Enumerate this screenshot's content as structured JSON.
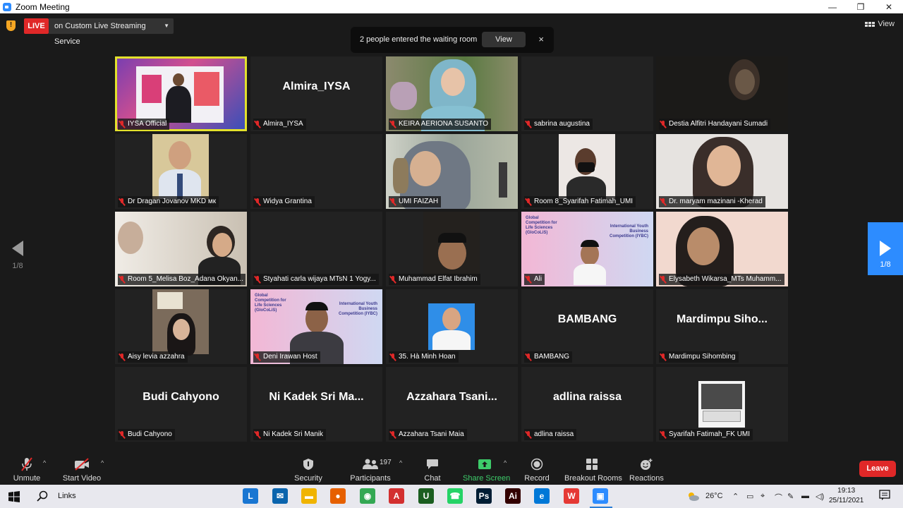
{
  "window": {
    "title": "Zoom Meeting",
    "controls": [
      "—",
      "❐",
      "✕"
    ]
  },
  "live": {
    "badge": "LIVE",
    "stream_label": "on Custom Live Streaming Service"
  },
  "notification": {
    "message": "2 people entered the waiting room",
    "view_label": "View",
    "close": "×"
  },
  "view_toggle": "View",
  "pagination": {
    "left": "1/8",
    "right": "1/8"
  },
  "tiles": [
    {
      "caption": "IYSA Official",
      "big": "",
      "active": true,
      "muted": false
    },
    {
      "caption": "Almira_IYSA",
      "big": "Almira_IYSA",
      "muted": true
    },
    {
      "caption": "KEIRA AERIONA SUSANTO",
      "big": "",
      "muted": true
    },
    {
      "caption": "sabrina augustina",
      "big": "",
      "muted": true
    },
    {
      "caption": "Destia Alfitri Handayani Sumadi",
      "big": "",
      "muted": true
    },
    {
      "caption": "Dr Dragan Jovanov MKD мк",
      "big": "",
      "muted": true
    },
    {
      "caption": "Widya Grantina",
      "big": "",
      "muted": true
    },
    {
      "caption": "UMI FAIZAH",
      "big": "",
      "muted": true
    },
    {
      "caption": "Room 8_Syarifah Fatimah_UMI",
      "big": "",
      "muted": true
    },
    {
      "caption": "Dr. maryam mazinani -Kherad",
      "big": "",
      "muted": true
    },
    {
      "caption": "Room 5_Melisa Boz_Adana Okyan...",
      "big": "",
      "muted": true
    },
    {
      "caption": "Styahati carla wijaya MTsN 1 Yogy...",
      "big": "",
      "muted": true
    },
    {
      "caption": "Muhammad Elfat Ibrahim",
      "big": "",
      "muted": true
    },
    {
      "caption": "Ali",
      "big": "",
      "muted": true
    },
    {
      "caption": "Elysabeth Wikarsa_MTs Muhamm...",
      "big": "",
      "muted": true
    },
    {
      "caption": "Aisy levia azzahra",
      "big": "",
      "muted": true
    },
    {
      "caption": "Deni Irawan Host",
      "big": "",
      "muted": true
    },
    {
      "caption": "35. Hà Minh Hoan",
      "big": "",
      "muted": true
    },
    {
      "caption": "BAMBANG",
      "big": "BAMBANG",
      "muted": true
    },
    {
      "caption": "Mardimpu Sihombing",
      "big": "Mardimpu Siho...",
      "muted": true
    },
    {
      "caption": "Budi Cahyono",
      "big": "Budi Cahyono",
      "muted": true
    },
    {
      "caption": "Ni Kadek Sri Manik",
      "big": "Ni Kadek Sri Ma...",
      "muted": true
    },
    {
      "caption": "Azzahara Tsani Maia",
      "big": "Azzahara  Tsani...",
      "muted": true
    },
    {
      "caption": "adlina raissa",
      "big": "adlina raissa",
      "muted": true
    },
    {
      "caption": "Syarifah Fatimah_FK UMI",
      "big": "",
      "muted": true
    }
  ],
  "slide_text": {
    "left": "Global Competition for Life Sciences (GloCoLiS)",
    "right": "International Youth Business Competition (IYBC)"
  },
  "toolbar": {
    "unmute": "Unmute",
    "start_video": "Start Video",
    "security": "Security",
    "participants": "Participants",
    "participants_count": "197",
    "chat": "Chat",
    "share_screen": "Share Screen",
    "record": "Record",
    "breakout_rooms": "Breakout Rooms",
    "reactions": "Reactions",
    "leave": "Leave"
  },
  "taskbar": {
    "search_label": "Links",
    "weather": "26°C",
    "time": "19:13",
    "date": "25/11/2021",
    "apps": [
      {
        "name": "L",
        "color": "#1976d2"
      },
      {
        "name": "✉",
        "color": "#0a64ad"
      },
      {
        "name": "▬",
        "color": "#f0b400"
      },
      {
        "name": "●",
        "color": "#e66000"
      },
      {
        "name": "◉",
        "color": "#34a853"
      },
      {
        "name": "A",
        "color": "#d32f2f"
      },
      {
        "name": "U",
        "color": "#1b5e20"
      },
      {
        "name": "☎",
        "color": "#25d366"
      },
      {
        "name": "Ps",
        "color": "#001d34"
      },
      {
        "name": "Ai",
        "color": "#330000"
      },
      {
        "name": "e",
        "color": "#0078d7"
      },
      {
        "name": "W",
        "color": "#e53935"
      },
      {
        "name": "▣",
        "color": "#2d8cff"
      }
    ]
  }
}
